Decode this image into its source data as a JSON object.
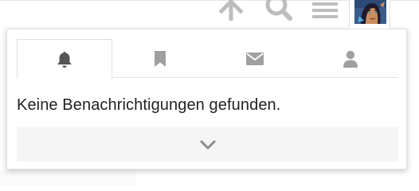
{
  "header": {
    "icons": [
      "arrow-up-icon",
      "search-icon",
      "menu-icon"
    ],
    "avatar": "user-avatar"
  },
  "notifications": {
    "tabs": [
      {
        "icon": "bell-icon",
        "active": true
      },
      {
        "icon": "bookmark-icon",
        "active": false
      },
      {
        "icon": "envelope-icon",
        "active": false
      },
      {
        "icon": "user-icon",
        "active": false
      }
    ],
    "empty_message": "Keine Benachrichtigungen gefunden.",
    "more_icon": "chevron-down-icon"
  },
  "colors": {
    "icon_gray": "#a0a0a0",
    "icon_active": "#555555",
    "text": "#222222",
    "more_bg": "#f5f5f5"
  }
}
